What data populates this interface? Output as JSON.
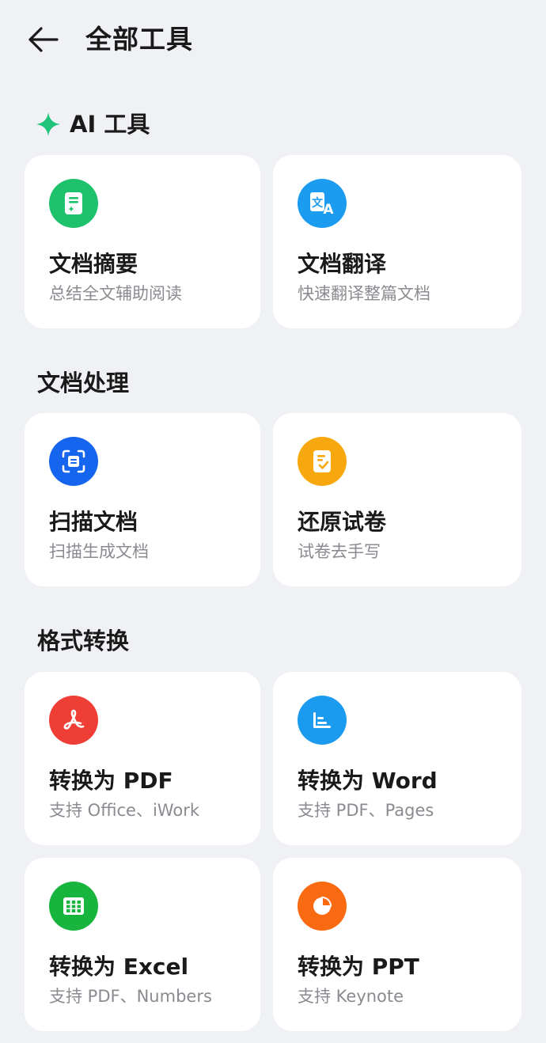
{
  "header": {
    "title": "全部工具",
    "back_icon": "arrow-left-icon"
  },
  "sections": {
    "ai": {
      "title": "AI 工具",
      "icon": "sparkle-icon",
      "icon_color": "#1fc47a"
    },
    "doc": {
      "title": "文档处理"
    },
    "convert": {
      "title": "格式转换"
    }
  },
  "cards": {
    "summary": {
      "title": "文档摘要",
      "subtitle": "总结全文辅助阅读",
      "icon": "document-summary-icon",
      "color": "#1ec16c"
    },
    "translate": {
      "title": "文档翻译",
      "subtitle": "快速翻译整篇文档",
      "icon": "translate-icon",
      "color": "#1c9cf0"
    },
    "scan": {
      "title": "扫描文档",
      "subtitle": "扫描生成文档",
      "icon": "scan-icon",
      "color": "#1565ee"
    },
    "exam": {
      "title": "还原试卷",
      "subtitle": "试卷去手写",
      "icon": "exam-paper-icon",
      "color": "#f7a80e"
    },
    "to_pdf": {
      "title": "转换为 PDF",
      "subtitle": "支持 Office、iWork",
      "icon": "pdf-icon",
      "color": "#ef3e36"
    },
    "to_word": {
      "title": "转换为 Word",
      "subtitle": "支持 PDF、Pages",
      "icon": "word-icon",
      "color": "#1a9bf0"
    },
    "to_excel": {
      "title": "转换为 Excel",
      "subtitle": "支持 PDF、Numbers",
      "icon": "excel-icon",
      "color": "#17b53e"
    },
    "to_ppt": {
      "title": "转换为 PPT",
      "subtitle": "支持 Keynote",
      "icon": "ppt-icon",
      "color": "#fa6a12"
    }
  }
}
